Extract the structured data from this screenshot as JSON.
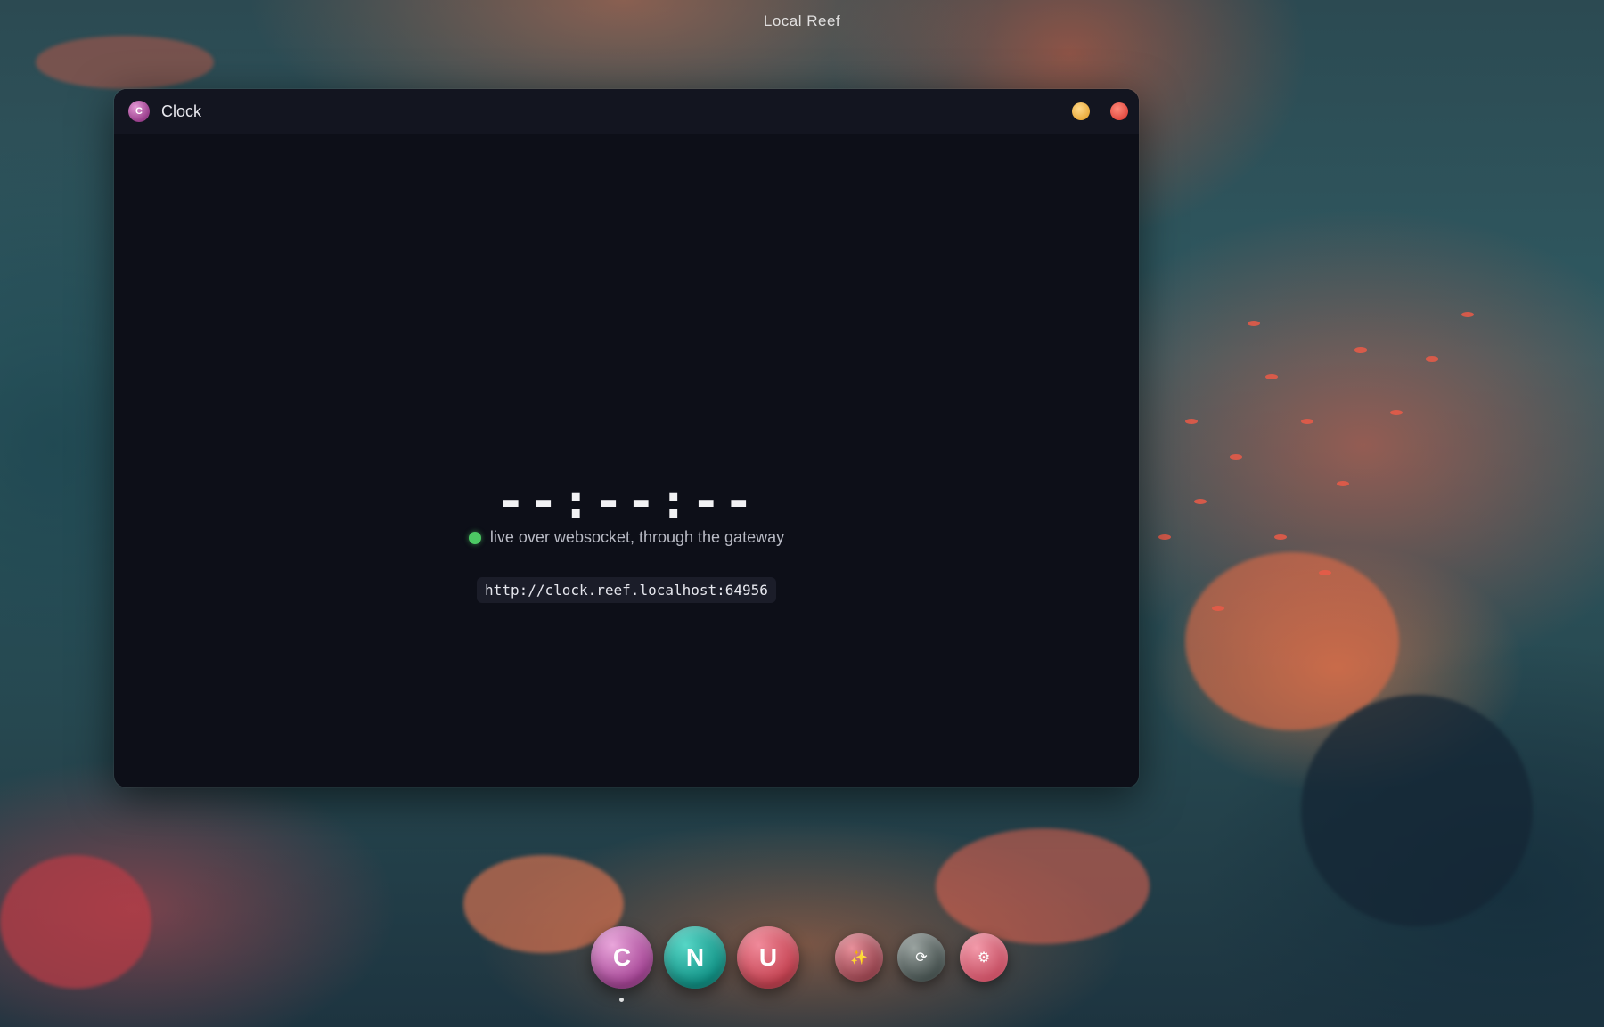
{
  "desktop": {
    "title": "Local Reef"
  },
  "window": {
    "icon_letter": "C",
    "title": "Clock",
    "minimize_icon": "minimize-dot",
    "close_icon": "close-dot"
  },
  "clock": {
    "time_display": "--:--:--",
    "status_text": "live over websocket, through the gateway",
    "status_color": "#4cc964",
    "url": "http://clock.reef.localhost:64956"
  },
  "dock": {
    "apps": [
      {
        "letter": "C",
        "color": "#a44394",
        "active": true
      },
      {
        "letter": "N",
        "color": "#0f8f83",
        "active": false
      },
      {
        "letter": "U",
        "color": "#c3404f",
        "active": false
      }
    ],
    "tools": [
      {
        "icon": "sparkle-icon",
        "glyph": "✨"
      },
      {
        "icon": "refresh-icon",
        "glyph": "⟳"
      },
      {
        "icon": "gear-icon",
        "glyph": "⚙"
      }
    ]
  }
}
